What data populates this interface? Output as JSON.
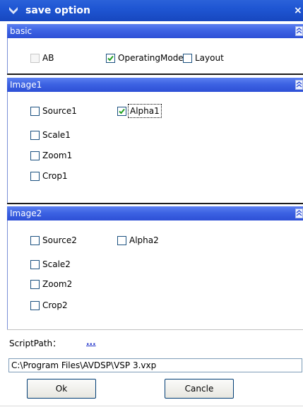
{
  "window": {
    "title": "save option",
    "close_label": "×"
  },
  "sections": [
    {
      "title": "basic",
      "items": [
        {
          "label": "AB",
          "checked": false,
          "disabled": true
        },
        {
          "label": "OperatingMode",
          "checked": true,
          "disabled": false
        },
        {
          "label": "Layout",
          "checked": false,
          "disabled": false
        }
      ]
    },
    {
      "title": "Image1",
      "items": [
        {
          "label": "Source1",
          "checked": false
        },
        {
          "label": "Alpha1",
          "checked": true
        },
        {
          "label": "Scale1",
          "checked": false
        },
        {
          "label": "Zoom1",
          "checked": false
        },
        {
          "label": "Crop1",
          "checked": false
        }
      ]
    },
    {
      "title": "Image2",
      "items": [
        {
          "label": "Source2",
          "checked": false
        },
        {
          "label": "Alpha2",
          "checked": false
        },
        {
          "label": "Scale2",
          "checked": false
        },
        {
          "label": "Zoom2",
          "checked": false
        },
        {
          "label": "Crop2",
          "checked": false
        }
      ]
    }
  ],
  "script": {
    "label": "ScriptPath：",
    "browse_label": "...",
    "path_value": "C:\\Program Files\\AVDSP\\VSP 3.vxp"
  },
  "buttons": {
    "ok_label": "Ok",
    "cancel_label": "Cancle"
  },
  "colors": {
    "title_bar": "#1f56d3",
    "section_header": "#3d63e3",
    "check": "#21a121"
  }
}
